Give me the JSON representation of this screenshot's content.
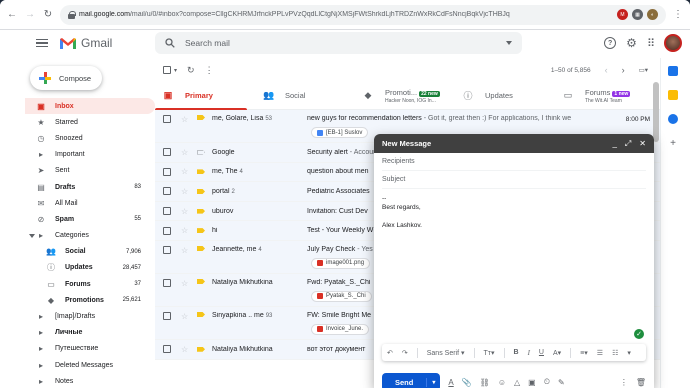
{
  "browser": {
    "url_domain": "mail.google.com",
    "url_path": "/mail/u/0/#inbox?compose=CllgCKHRMJrfnckPPLvPVzQqdLlCtgNjXMSjFWtShrkdLjhTRDZnWxRkCdFsNncjBqkVjcTHBJq"
  },
  "header": {
    "product": "Gmail",
    "search_placeholder": "Search mail"
  },
  "sidebar": {
    "compose_label": "Compose",
    "items": [
      {
        "label": "Inbox",
        "count": "",
        "icon": "inbox-icon",
        "glyph": "▣",
        "active": true,
        "bold": true
      },
      {
        "label": "Starred",
        "count": "",
        "icon": "star-icon",
        "glyph": "★"
      },
      {
        "label": "Snoozed",
        "count": "",
        "icon": "clock-icon",
        "glyph": "◷"
      },
      {
        "label": "Important",
        "count": "",
        "icon": "important-icon",
        "glyph": "▸"
      },
      {
        "label": "Sent",
        "count": "",
        "icon": "send-icon",
        "glyph": "➤"
      },
      {
        "label": "Drafts",
        "count": "83",
        "icon": "draft-icon",
        "glyph": "▤",
        "bold": true
      },
      {
        "label": "All Mail",
        "count": "",
        "icon": "mail-icon",
        "glyph": "✉"
      },
      {
        "label": "Spam",
        "count": "55",
        "icon": "spam-icon",
        "glyph": "⊘",
        "bold": true
      },
      {
        "label": "Categories",
        "count": "",
        "icon": "label-icon",
        "glyph": "▸",
        "caret": true
      },
      {
        "label": "Social",
        "count": "7,906",
        "icon": "people-icon",
        "glyph": "👥",
        "sub": true,
        "bold": true
      },
      {
        "label": "Updates",
        "count": "28,457",
        "icon": "info-icon",
        "glyph": "ⓘ",
        "sub": true,
        "bold": true
      },
      {
        "label": "Forums",
        "count": "37",
        "icon": "forum-icon",
        "glyph": "▭",
        "sub": true,
        "bold": true
      },
      {
        "label": "Promotions",
        "count": "25,621",
        "icon": "tag-icon",
        "glyph": "◆",
        "sub": true,
        "bold": true
      },
      {
        "label": "[Imap]/Drafts",
        "count": "",
        "icon": "label-icon",
        "glyph": "▸"
      },
      {
        "label": "Личные",
        "count": "",
        "icon": "label-icon",
        "glyph": "▸",
        "bold": true
      },
      {
        "label": "Путешествие",
        "count": "",
        "icon": "label-icon",
        "glyph": "▸"
      },
      {
        "label": "Deleted Messages",
        "count": "",
        "icon": "label-icon",
        "glyph": "▸"
      },
      {
        "label": "Notes",
        "count": "",
        "icon": "label-icon",
        "glyph": "▸"
      }
    ]
  },
  "toolbar": {
    "range": "1–50 of 5,856"
  },
  "tabs": [
    {
      "label": "Primary",
      "sub": "",
      "icon": "inbox-tab-icon",
      "glyph": "▣",
      "active": true
    },
    {
      "label": "Social",
      "sub": "",
      "icon": "people-icon",
      "glyph": "👥"
    },
    {
      "label": "Promoti...",
      "sub": "Hacker Noon, IOG In...",
      "badge": "22 new",
      "badge_color": "#188038",
      "icon": "tag-icon",
      "glyph": "◆"
    },
    {
      "label": "Updates",
      "sub": "",
      "icon": "info-icon",
      "glyph": "ⓘ"
    },
    {
      "label": "Forums",
      "sub": "The Wit.AI Team",
      "badge": "1 new",
      "badge_color": "#9334e6",
      "icon": "forum-icon",
      "glyph": "▭"
    }
  ],
  "emails": [
    {
      "sender": "me, Golare, Lisa",
      "n": "53",
      "subject": "new guys for recommendation letters",
      "snippet": " - Got it, great then :) For applications, I think we",
      "time": "8:00 PM",
      "important": true,
      "chip": "[EB-1] Suslov",
      "chip_color": "#4285f4",
      "tall": true
    },
    {
      "sender": "Google",
      "n": "",
      "subject": "Security alert",
      "snippet": " - Account sec",
      "time": "",
      "important": false
    },
    {
      "sender": "me, The",
      "n": "4",
      "subject": "question about men",
      "snippet": "",
      "time": "",
      "important": true
    },
    {
      "sender": "portal",
      "n": "2",
      "subject": "Pediatric Associates",
      "snippet": "",
      "time": "",
      "important": true
    },
    {
      "sender": "uburov",
      "n": "",
      "subject": "Invitation: Cust Dev",
      "snippet": "",
      "time": "",
      "important": true
    },
    {
      "sender": "hi",
      "n": "",
      "subject": "Test - Your Weekly W",
      "snippet": "",
      "time": "",
      "important": true
    },
    {
      "sender": "Jeannette, me",
      "n": "4",
      "subject": "July Pay Check",
      "snippet": " - Yes",
      "time": "",
      "important": true,
      "chip": "image001.png",
      "chip_color": "#d93025",
      "tall": true
    },
    {
      "sender": "Nataliya Mikhutkina",
      "n": "",
      "subject": "Fwd: Pyatak_S._Chi",
      "snippet": "",
      "time": "",
      "important": true,
      "chip": "Pyatak_S._Chi",
      "chip_color": "#d93025",
      "tall": true
    },
    {
      "sender": "Sinyapkina .. me",
      "n": "93",
      "subject": "FW: Smile Bright Me",
      "snippet": "",
      "time": "",
      "important": true,
      "chip": "Invoice_June.",
      "chip_color": "#d93025",
      "tall": true
    },
    {
      "sender": "Nataliya Mikhutkina",
      "n": "",
      "subject": "вот этот документ",
      "snippet": "",
      "time": "",
      "important": true
    }
  ],
  "compose": {
    "title": "New Message",
    "recipients_placeholder": "Recipients",
    "subject_placeholder": "Subject",
    "body_lines": [
      "--",
      "Best regards,",
      "",
      "Alex Lashkov."
    ],
    "font": "Sans Serif",
    "send_label": "Send"
  }
}
